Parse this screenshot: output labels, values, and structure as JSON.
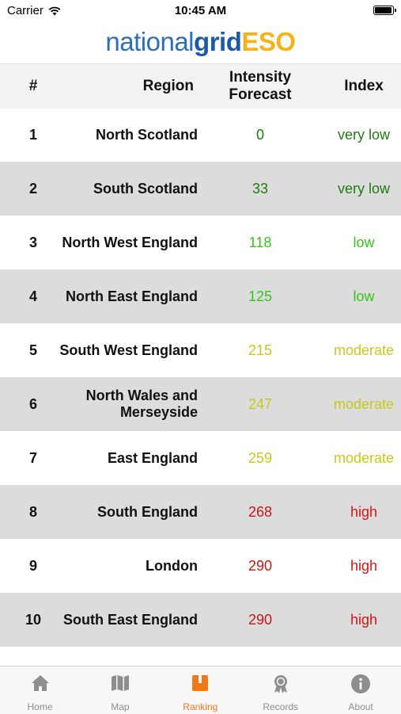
{
  "status_bar": {
    "carrier": "Carrier",
    "time": "10:45 AM",
    "battery_level": 1.0
  },
  "logo": {
    "part1": "national",
    "part2": "grid",
    "part3": "ESO"
  },
  "table": {
    "headers": {
      "rank": "#",
      "region": "Region",
      "intensity_line1": "Intensity",
      "intensity_line2": "Forecast",
      "index": "Index"
    },
    "rows": [
      {
        "rank": "1",
        "region": "North Scotland",
        "intensity": "0",
        "index": "very low"
      },
      {
        "rank": "2",
        "region": "South Scotland",
        "intensity": "33",
        "index": "very low"
      },
      {
        "rank": "3",
        "region": "North West England",
        "intensity": "118",
        "index": "low"
      },
      {
        "rank": "4",
        "region": "North East England",
        "intensity": "125",
        "index": "low"
      },
      {
        "rank": "5",
        "region": "South West England",
        "intensity": "215",
        "index": "moderate"
      },
      {
        "rank": "6",
        "region": "North Wales and Merseyside",
        "intensity": "247",
        "index": "moderate"
      },
      {
        "rank": "7",
        "region": "East England",
        "intensity": "259",
        "index": "moderate"
      },
      {
        "rank": "8",
        "region": "South England",
        "intensity": "268",
        "index": "high"
      },
      {
        "rank": "9",
        "region": "London",
        "intensity": "290",
        "index": "high"
      },
      {
        "rank": "10",
        "region": "South East England",
        "intensity": "290",
        "index": "high"
      }
    ]
  },
  "index_colors": {
    "very low": "#1f7a12",
    "low": "#3ac21c",
    "moderate": "#c8c81c",
    "high": "#cc1616"
  },
  "tabbar": {
    "tabs": [
      {
        "label": "Home",
        "icon": "home-icon"
      },
      {
        "label": "Map",
        "icon": "map-icon"
      },
      {
        "label": "Ranking",
        "icon": "ranking-book-icon"
      },
      {
        "label": "Records",
        "icon": "award-ribbon-icon"
      },
      {
        "label": "About",
        "icon": "info-icon"
      }
    ],
    "active_tab": "Ranking",
    "inactive_color": "#8e8e8e",
    "active_color": "#f07a1a"
  }
}
